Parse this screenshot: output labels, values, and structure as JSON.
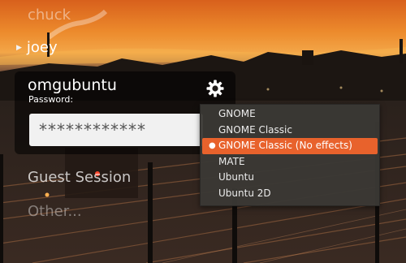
{
  "users": [
    {
      "name": "chuck"
    },
    {
      "name": "joey"
    }
  ],
  "login": {
    "username": "omgubuntu",
    "password_label": "Password:",
    "password_value": "************"
  },
  "guest_label": "Guest Session",
  "other_label": "Other...",
  "session_menu": {
    "icon": "gear-icon",
    "selected_index": 2,
    "items": [
      {
        "label": "GNOME"
      },
      {
        "label": "GNOME Classic"
      },
      {
        "label": "GNOME Classic (No effects)"
      },
      {
        "label": "MATE"
      },
      {
        "label": "Ubuntu"
      },
      {
        "label": "Ubuntu 2D"
      }
    ]
  },
  "colors": {
    "accent": "#e8622c",
    "menu_bg": "#3a3834",
    "field_bg": "#f1f1f1"
  }
}
